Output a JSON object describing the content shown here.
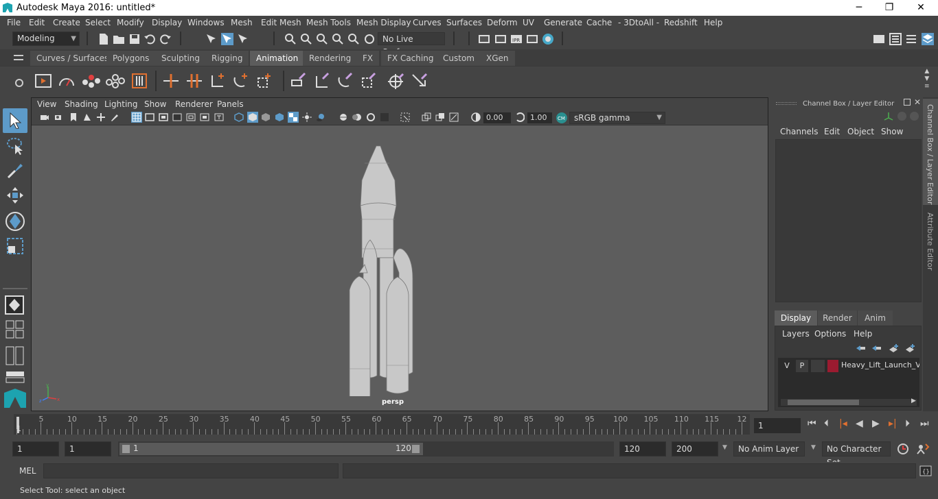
{
  "window": {
    "title": "Autodesk Maya 2016: untitled*",
    "minimize": "─",
    "restore": "❐",
    "close": "✕"
  },
  "menubar": [
    "File",
    "Edit",
    "Create",
    "Select",
    "Modify",
    "Display",
    "Windows",
    "Mesh",
    "Edit Mesh",
    "Mesh Tools",
    "Mesh Display",
    "Curves",
    "Surfaces",
    "Deform",
    "UV",
    "Generate",
    "Cache",
    "- 3DtoAll -",
    "Redshift",
    "Help"
  ],
  "statusline": {
    "mode": "Modeling",
    "live_surface": "No Live Surface"
  },
  "shelf_tabs": [
    {
      "label": "Curves / Surfaces",
      "active": false
    },
    {
      "label": "Polygons",
      "active": false
    },
    {
      "label": "Sculpting",
      "active": false
    },
    {
      "label": "Rigging",
      "active": false
    },
    {
      "label": "Animation",
      "active": true
    },
    {
      "label": "Rendering",
      "active": false
    },
    {
      "label": "FX",
      "active": false
    },
    {
      "label": "FX Caching",
      "active": false
    },
    {
      "label": "Custom",
      "active": false
    },
    {
      "label": "XGen",
      "active": false
    }
  ],
  "viewport": {
    "menu": [
      "View",
      "Shading",
      "Lighting",
      "Show",
      "Renderer",
      "Panels"
    ],
    "exposure": "0.00",
    "gamma": "1.00",
    "color_space": "sRGB gamma",
    "camera_label": "persp"
  },
  "channel_box": {
    "title": "Channel Box / Layer Editor",
    "menu": [
      "Channels",
      "Edit",
      "Object",
      "Show"
    ],
    "layer_tabs": [
      {
        "label": "Display",
        "active": true
      },
      {
        "label": "Render",
        "active": false
      },
      {
        "label": "Anim",
        "active": false
      }
    ],
    "layer_menu": [
      "Layers",
      "Options",
      "Help"
    ],
    "layer": {
      "visible": "V",
      "playback": "P",
      "name": "Heavy_Lift_Launch_Vel",
      "color": "#9b1b30"
    }
  },
  "side_tabs": [
    "Channel Box / Layer Editor",
    "Attribute Editor"
  ],
  "timeline": {
    "tick_labels": [
      "5",
      "10",
      "15",
      "20",
      "25",
      "30",
      "35",
      "40",
      "45",
      "50",
      "55",
      "60",
      "65",
      "70",
      "75",
      "80",
      "85",
      "90",
      "95",
      "100",
      "105",
      "110",
      "115",
      "12"
    ],
    "start_marker": "1",
    "current_frame": "1"
  },
  "range": {
    "start": "1",
    "anim_start": "1",
    "slider_start": "1",
    "slider_end": "120",
    "end": "120",
    "anim_end": "200",
    "anim_layer": "No Anim Layer",
    "character_set": "No Character Set"
  },
  "mel": {
    "label": "MEL"
  },
  "help_line": "Select Tool: select an object",
  "accent_color": "#5d9bc9"
}
